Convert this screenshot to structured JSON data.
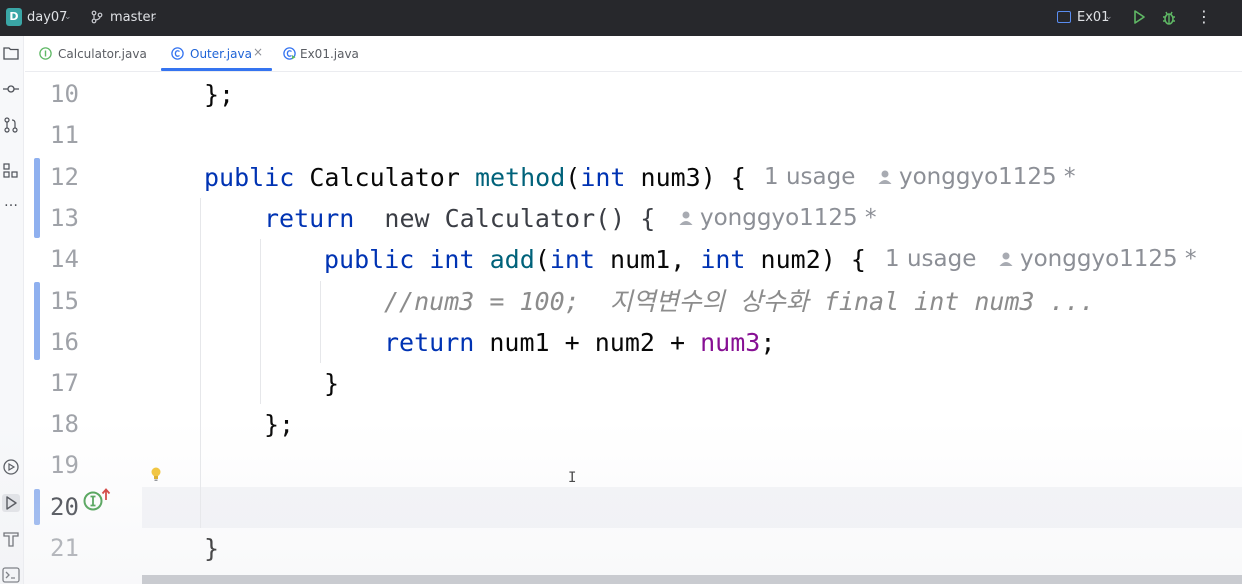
{
  "titlebar": {
    "project_badge": "D",
    "project_name": "day07",
    "branch_name": "master",
    "run_config": "Ex01",
    "icons": [
      "branch-icon",
      "run-config-icon",
      "run-icon",
      "debug-icon",
      "more-icon"
    ]
  },
  "tabs": [
    {
      "label": "Calculator.java",
      "icon": "interface-icon",
      "active": false
    },
    {
      "label": "Outer.java",
      "icon": "class-icon",
      "active": true,
      "close": "×"
    },
    {
      "label": "Ex01.java",
      "icon": "class-run-icon",
      "active": false
    }
  ],
  "toolstrip_icons": [
    "project-icon",
    "commit-icon",
    "pull-requests-icon",
    "structure-icon",
    "more-tools-icon",
    "services-icon",
    "run-icon",
    "build-icon",
    "terminal-icon"
  ],
  "editor": {
    "current_line": "20",
    "lines": [
      {
        "num": "10",
        "parts": [
          "};"
        ]
      },
      {
        "num": "11",
        "parts": []
      },
      {
        "num": "12",
        "parts": [
          "public",
          " Calculator ",
          "method",
          "(",
          "int",
          " num3) {"
        ],
        "usage_hint": "1 usage",
        "author_hint": "yonggyo1125 *"
      },
      {
        "num": "13",
        "parts": [
          "return",
          "  new Calculator() {"
        ],
        "author_hint": "yonggyo1125 *"
      },
      {
        "num": "14",
        "parts": [
          "public",
          " ",
          "int",
          " ",
          "add",
          "(",
          "int",
          " num1, ",
          "int",
          " num2) {"
        ],
        "usage_hint": "1 usage",
        "author_hint": "yonggyo1125 *"
      },
      {
        "num": "15",
        "comment": "//num3 = 100;  지역변수의 상수화 final int num3 ..."
      },
      {
        "num": "16",
        "parts": [
          "return",
          " num1 + num2 + ",
          "num3",
          ";"
        ]
      },
      {
        "num": "17",
        "parts": [
          "}"
        ]
      },
      {
        "num": "18",
        "parts": [
          "};"
        ]
      },
      {
        "num": "19",
        "parts": []
      },
      {
        "num": "20",
        "parts": []
      },
      {
        "num": "21",
        "parts": [
          "}"
        ]
      }
    ]
  },
  "colors": {
    "keyword": "#0033b3",
    "method": "#00627a",
    "field": "#871094",
    "comment": "#8c8c8c",
    "titlebar_bg": "#27282c",
    "tab_active": "#3574f0"
  }
}
